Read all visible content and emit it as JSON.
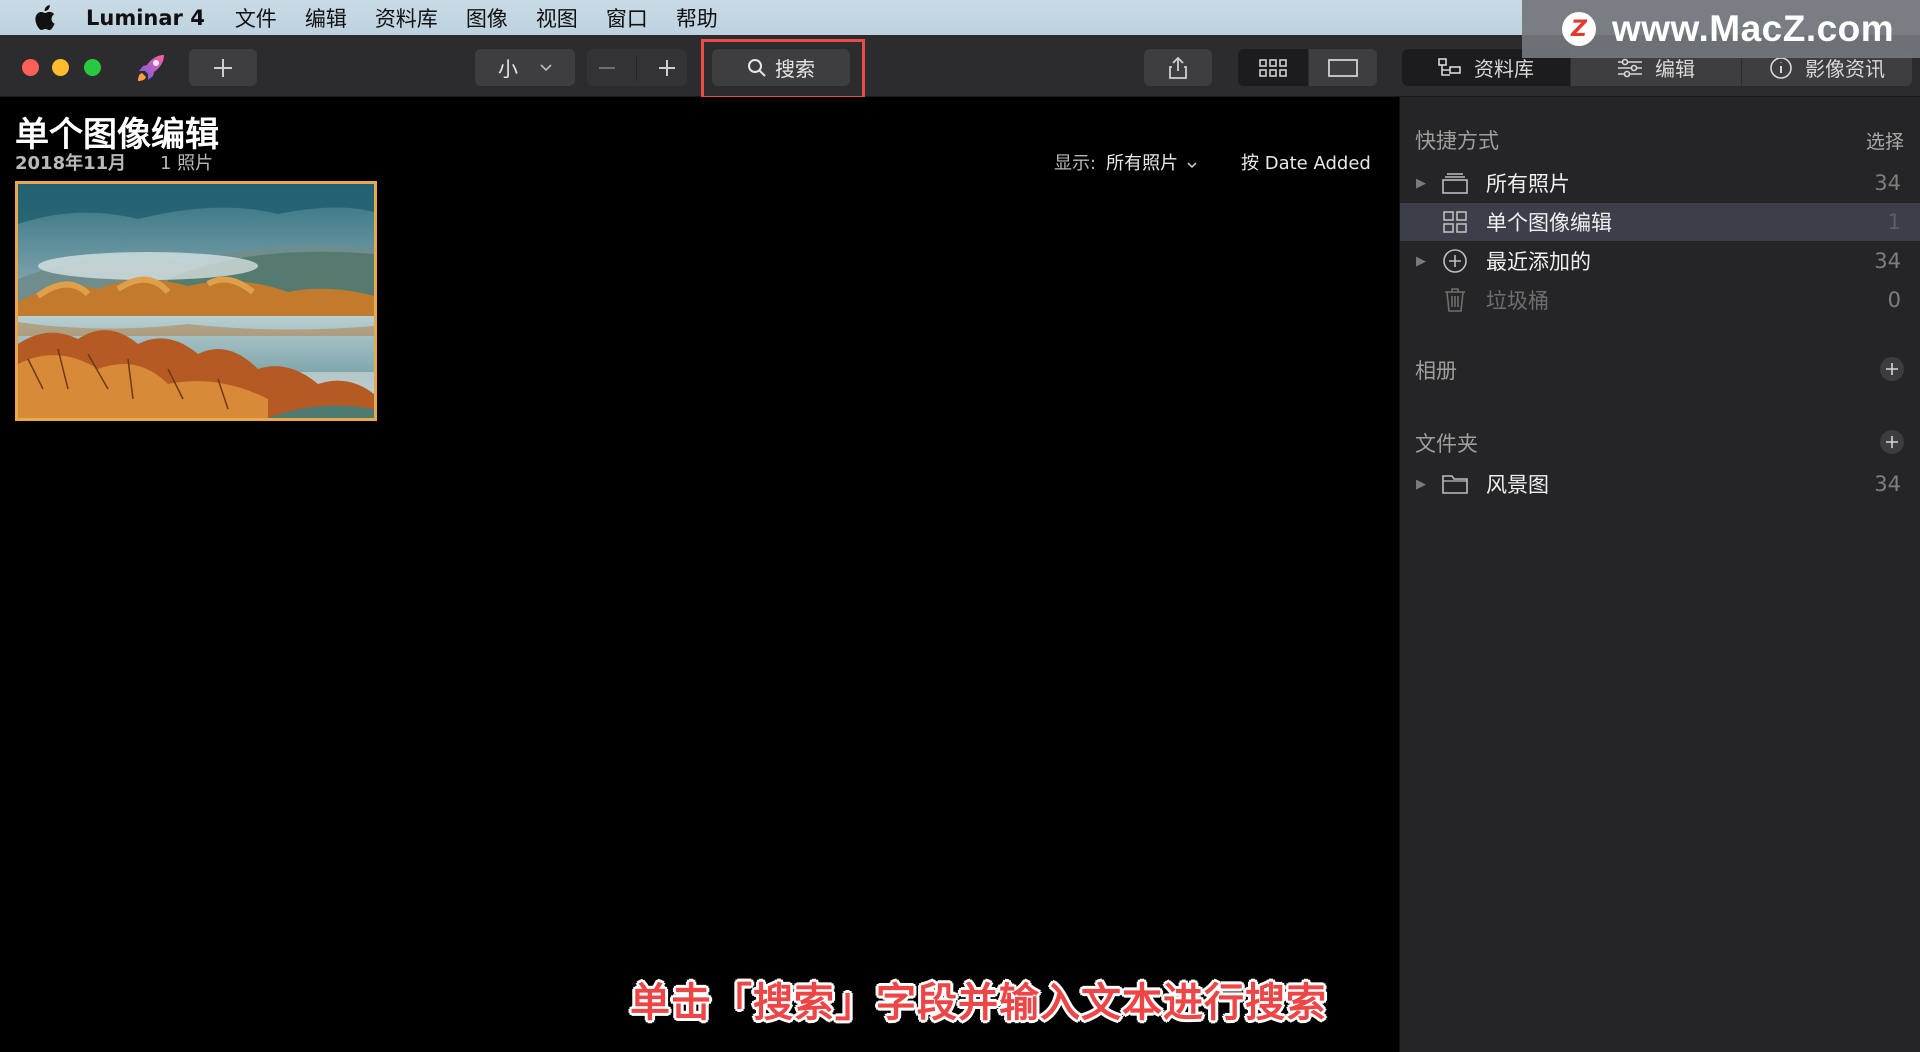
{
  "menubar": {
    "app_name": "Luminar 4",
    "items": [
      "文件",
      "编辑",
      "资料库",
      "图像",
      "视图",
      "窗口",
      "帮助"
    ]
  },
  "watermark": {
    "logo": "Z",
    "text": "www.MacZ.com"
  },
  "toolbar": {
    "size_select": "小",
    "search_label": "搜索",
    "tabs": {
      "library": "资料库",
      "edit": "编辑",
      "info": "影像资讯"
    }
  },
  "main": {
    "title": "单个图像编辑",
    "date": "2018年11月",
    "count": "1 照片",
    "filter_label": "显示:",
    "filter_value": "所有照片",
    "sort_label": "按 Date Added"
  },
  "sidebar": {
    "shortcuts_title": "快捷方式",
    "select_label": "选择",
    "shortcuts": [
      {
        "label": "所有照片",
        "count": "34"
      },
      {
        "label": "单个图像编辑",
        "count": "1"
      },
      {
        "label": "最近添加的",
        "count": "34"
      },
      {
        "label": "垃圾桶",
        "count": "0"
      }
    ],
    "albums_title": "相册",
    "folders_title": "文件夹",
    "folders": [
      {
        "label": "风景图",
        "count": "34"
      }
    ]
  },
  "caption": "单击「搜索」字段并输入文本进行搜索",
  "colors": {
    "accent_highlight": "#ee4b46",
    "selection_border": "#e8a84c",
    "sidebar_bg": "#252527",
    "toolbar_bg": "#2c2c2e"
  }
}
